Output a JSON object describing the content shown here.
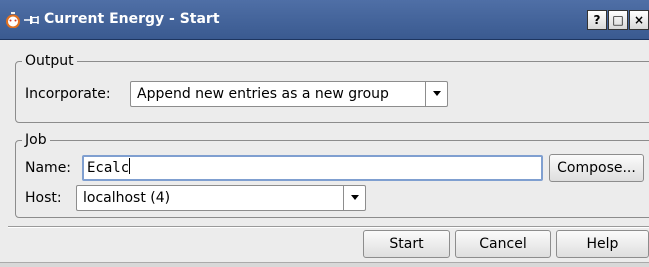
{
  "window": {
    "title": "Current Energy - Start",
    "app_icon": "stopwatch-icon",
    "pin_icon": "pin-icon",
    "help_glyph": "?",
    "maximize_glyph": "□",
    "close_glyph": "×"
  },
  "output": {
    "group_title": "Output",
    "incorporate_label": "Incorporate:",
    "incorporate_value": "Append new entries as a new group"
  },
  "job": {
    "group_title": "Job",
    "name_label": "Name:",
    "name_value": "Ecalc",
    "compose_label": "Compose...",
    "host_label": "Host:",
    "host_value": "localhost (4)"
  },
  "buttons": {
    "start": "Start",
    "cancel": "Cancel",
    "help": "Help"
  },
  "colors": {
    "titlebar": "#3f5f96",
    "input_focus_border": "#7f9fd0",
    "app_icon_accent": "#e07020"
  }
}
